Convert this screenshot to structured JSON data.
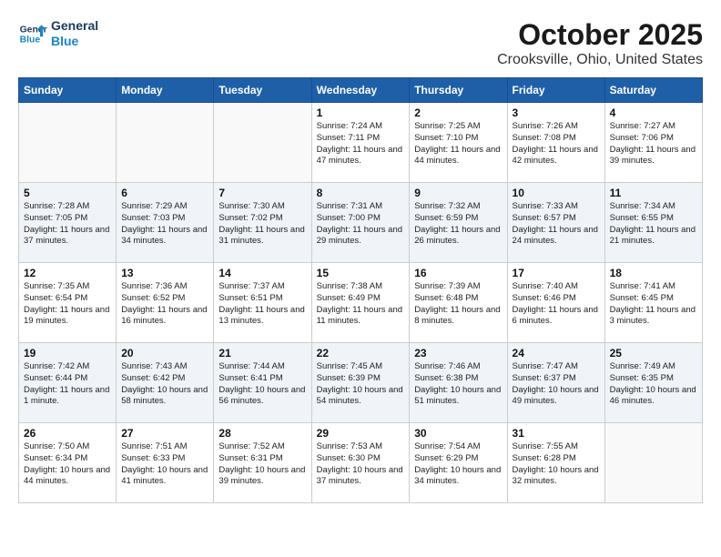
{
  "header": {
    "logo_line1": "General",
    "logo_line2": "Blue",
    "month": "October 2025",
    "location": "Crooksville, Ohio, United States"
  },
  "days_of_week": [
    "Sunday",
    "Monday",
    "Tuesday",
    "Wednesday",
    "Thursday",
    "Friday",
    "Saturday"
  ],
  "weeks": [
    [
      {
        "day": "",
        "text": ""
      },
      {
        "day": "",
        "text": ""
      },
      {
        "day": "",
        "text": ""
      },
      {
        "day": "1",
        "text": "Sunrise: 7:24 AM\nSunset: 7:11 PM\nDaylight: 11 hours and 47 minutes."
      },
      {
        "day": "2",
        "text": "Sunrise: 7:25 AM\nSunset: 7:10 PM\nDaylight: 11 hours and 44 minutes."
      },
      {
        "day": "3",
        "text": "Sunrise: 7:26 AM\nSunset: 7:08 PM\nDaylight: 11 hours and 42 minutes."
      },
      {
        "day": "4",
        "text": "Sunrise: 7:27 AM\nSunset: 7:06 PM\nDaylight: 11 hours and 39 minutes."
      }
    ],
    [
      {
        "day": "5",
        "text": "Sunrise: 7:28 AM\nSunset: 7:05 PM\nDaylight: 11 hours and 37 minutes."
      },
      {
        "day": "6",
        "text": "Sunrise: 7:29 AM\nSunset: 7:03 PM\nDaylight: 11 hours and 34 minutes."
      },
      {
        "day": "7",
        "text": "Sunrise: 7:30 AM\nSunset: 7:02 PM\nDaylight: 11 hours and 31 minutes."
      },
      {
        "day": "8",
        "text": "Sunrise: 7:31 AM\nSunset: 7:00 PM\nDaylight: 11 hours and 29 minutes."
      },
      {
        "day": "9",
        "text": "Sunrise: 7:32 AM\nSunset: 6:59 PM\nDaylight: 11 hours and 26 minutes."
      },
      {
        "day": "10",
        "text": "Sunrise: 7:33 AM\nSunset: 6:57 PM\nDaylight: 11 hours and 24 minutes."
      },
      {
        "day": "11",
        "text": "Sunrise: 7:34 AM\nSunset: 6:55 PM\nDaylight: 11 hours and 21 minutes."
      }
    ],
    [
      {
        "day": "12",
        "text": "Sunrise: 7:35 AM\nSunset: 6:54 PM\nDaylight: 11 hours and 19 minutes."
      },
      {
        "day": "13",
        "text": "Sunrise: 7:36 AM\nSunset: 6:52 PM\nDaylight: 11 hours and 16 minutes."
      },
      {
        "day": "14",
        "text": "Sunrise: 7:37 AM\nSunset: 6:51 PM\nDaylight: 11 hours and 13 minutes."
      },
      {
        "day": "15",
        "text": "Sunrise: 7:38 AM\nSunset: 6:49 PM\nDaylight: 11 hours and 11 minutes."
      },
      {
        "day": "16",
        "text": "Sunrise: 7:39 AM\nSunset: 6:48 PM\nDaylight: 11 hours and 8 minutes."
      },
      {
        "day": "17",
        "text": "Sunrise: 7:40 AM\nSunset: 6:46 PM\nDaylight: 11 hours and 6 minutes."
      },
      {
        "day": "18",
        "text": "Sunrise: 7:41 AM\nSunset: 6:45 PM\nDaylight: 11 hours and 3 minutes."
      }
    ],
    [
      {
        "day": "19",
        "text": "Sunrise: 7:42 AM\nSunset: 6:44 PM\nDaylight: 11 hours and 1 minute."
      },
      {
        "day": "20",
        "text": "Sunrise: 7:43 AM\nSunset: 6:42 PM\nDaylight: 10 hours and 58 minutes."
      },
      {
        "day": "21",
        "text": "Sunrise: 7:44 AM\nSunset: 6:41 PM\nDaylight: 10 hours and 56 minutes."
      },
      {
        "day": "22",
        "text": "Sunrise: 7:45 AM\nSunset: 6:39 PM\nDaylight: 10 hours and 54 minutes."
      },
      {
        "day": "23",
        "text": "Sunrise: 7:46 AM\nSunset: 6:38 PM\nDaylight: 10 hours and 51 minutes."
      },
      {
        "day": "24",
        "text": "Sunrise: 7:47 AM\nSunset: 6:37 PM\nDaylight: 10 hours and 49 minutes."
      },
      {
        "day": "25",
        "text": "Sunrise: 7:49 AM\nSunset: 6:35 PM\nDaylight: 10 hours and 46 minutes."
      }
    ],
    [
      {
        "day": "26",
        "text": "Sunrise: 7:50 AM\nSunset: 6:34 PM\nDaylight: 10 hours and 44 minutes."
      },
      {
        "day": "27",
        "text": "Sunrise: 7:51 AM\nSunset: 6:33 PM\nDaylight: 10 hours and 41 minutes."
      },
      {
        "day": "28",
        "text": "Sunrise: 7:52 AM\nSunset: 6:31 PM\nDaylight: 10 hours and 39 minutes."
      },
      {
        "day": "29",
        "text": "Sunrise: 7:53 AM\nSunset: 6:30 PM\nDaylight: 10 hours and 37 minutes."
      },
      {
        "day": "30",
        "text": "Sunrise: 7:54 AM\nSunset: 6:29 PM\nDaylight: 10 hours and 34 minutes."
      },
      {
        "day": "31",
        "text": "Sunrise: 7:55 AM\nSunset: 6:28 PM\nDaylight: 10 hours and 32 minutes."
      },
      {
        "day": "",
        "text": ""
      }
    ]
  ]
}
